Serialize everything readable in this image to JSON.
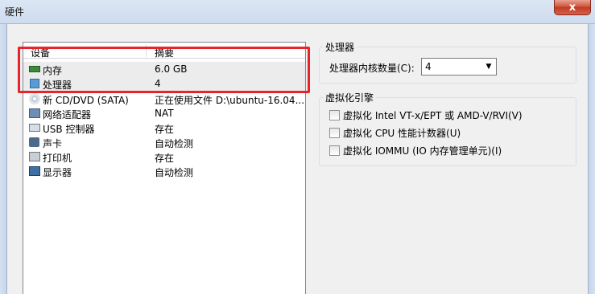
{
  "window": {
    "title": "硬件",
    "close_symbol": "x"
  },
  "device_list": {
    "columns": {
      "device": "设备",
      "summary": "摘要"
    },
    "rows": [
      {
        "icon": "memory-icon",
        "name": "内存",
        "value": "6.0 GB"
      },
      {
        "icon": "processor-icon",
        "name": "处理器",
        "value": "4"
      },
      {
        "icon": "cd-dvd-icon",
        "name": "新 CD/DVD (SATA)",
        "value": "正在使用文件 D:\\ubuntu-16.04..."
      },
      {
        "icon": "network-adapter-icon",
        "name": "网络适配器",
        "value": "NAT"
      },
      {
        "icon": "usb-controller-icon",
        "name": "USB 控制器",
        "value": "存在"
      },
      {
        "icon": "sound-card-icon",
        "name": "声卡",
        "value": "自动检测"
      },
      {
        "icon": "printer-icon",
        "name": "打印机",
        "value": "存在"
      },
      {
        "icon": "display-icon",
        "name": "显示器",
        "value": "自动检测"
      }
    ]
  },
  "processor_group": {
    "title": "处理器",
    "cores_label": "处理器内核数量(C):",
    "cores_value": "4"
  },
  "virtualization_group": {
    "title": "虚拟化引擎",
    "options": [
      {
        "label": "虚拟化 Intel VT-x/EPT 或 AMD-V/RVI(V)",
        "checked": false
      },
      {
        "label": "虚拟化 CPU 性能计数器(U)",
        "checked": false
      },
      {
        "label": "虚拟化 IOMMU (IO 内存管理单元)(I)",
        "checked": false
      }
    ]
  }
}
